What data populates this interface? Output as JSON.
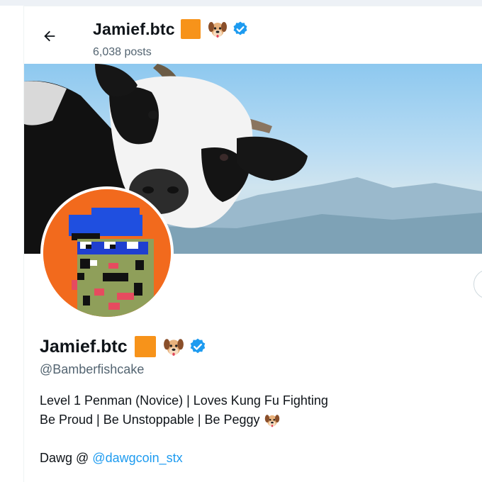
{
  "header": {
    "back_icon": "arrow-left-icon",
    "display_name": "Jamief.btc",
    "posts_count": "6,038 posts",
    "badges": [
      "orange-square-icon",
      "dog-face-icon",
      "verified-badge-icon"
    ]
  },
  "profile": {
    "display_name": "Jamief.btc",
    "handle": "@Bamberfishcake",
    "bio": {
      "line1": "Level 1 Penman (Novice) | Loves Kung Fu Fighting",
      "line2": "Be Proud | Be Unstoppable | Be Peggy",
      "line3_prefix": "Dawg @",
      "line3_link": "@dawgcoin_stx"
    }
  },
  "colors": {
    "accent": "#1d9bf0",
    "bitcoin_orange": "#f7931a",
    "avatar_background": "#f26a1d",
    "secondary_text": "#536471"
  }
}
